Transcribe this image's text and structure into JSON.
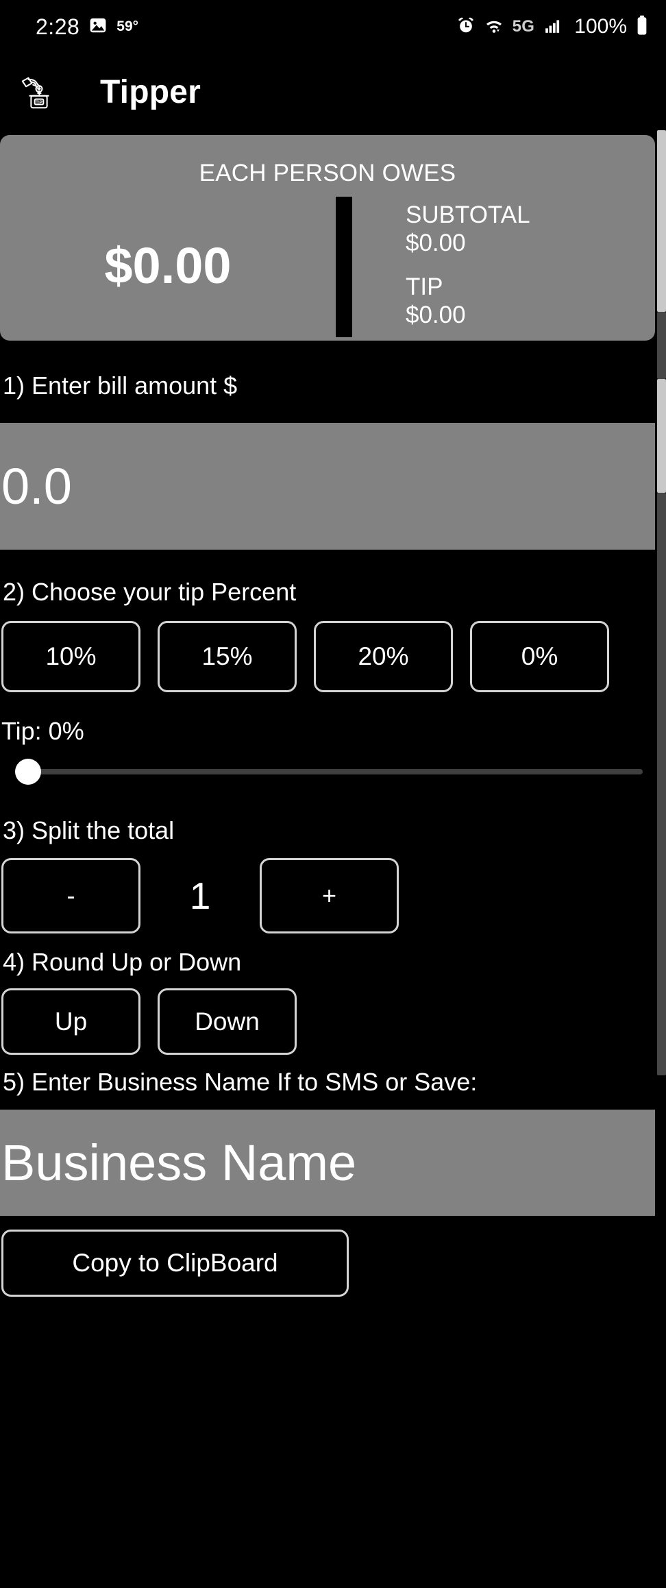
{
  "status_bar": {
    "time": "2:28",
    "gallery_icon": "image-icon",
    "temperature": "59°",
    "alarm_icon": "alarm-clock-icon",
    "wifi_icon": "wifi-icon",
    "network": "5G",
    "signal_icon": "signal-bars-icon",
    "battery_percent": "100%",
    "battery_icon": "battery-full-icon"
  },
  "app_bar": {
    "icon": "tip-jar-icon",
    "title": "Tipper"
  },
  "summary": {
    "heading": "EACH PERSON OWES",
    "total": "$0.00",
    "subtotal_label": "SUBTOTAL",
    "subtotal_value": "$0.00",
    "tip_label": "TIP",
    "tip_value": "$0.00"
  },
  "bill": {
    "label": "1) Enter bill amount $",
    "value": "0.0",
    "placeholder": "0.0"
  },
  "tip_percent": {
    "label": "2) Choose your tip Percent",
    "options": [
      "10%",
      "15%",
      "20%",
      "0%"
    ],
    "readout": "Tip: 0%",
    "slider_value": 0,
    "slider_min": 0,
    "slider_max": 100
  },
  "split": {
    "label": "3) Split the total",
    "decrement": "-",
    "count": "1",
    "increment": "+"
  },
  "rounding": {
    "label": "4) Round Up or Down",
    "up": "Up",
    "down": "Down"
  },
  "business": {
    "label": "5) Enter Business Name If to SMS or Save:",
    "value": "Business Name",
    "placeholder": "Business Name"
  },
  "actions": {
    "copy_clipboard": "Copy to ClipBoard"
  },
  "colors": {
    "background": "#000000",
    "surface": "#828282",
    "text": "#ffffff",
    "border": "#d4d4d4",
    "slider_track": "#3f3f3f"
  }
}
